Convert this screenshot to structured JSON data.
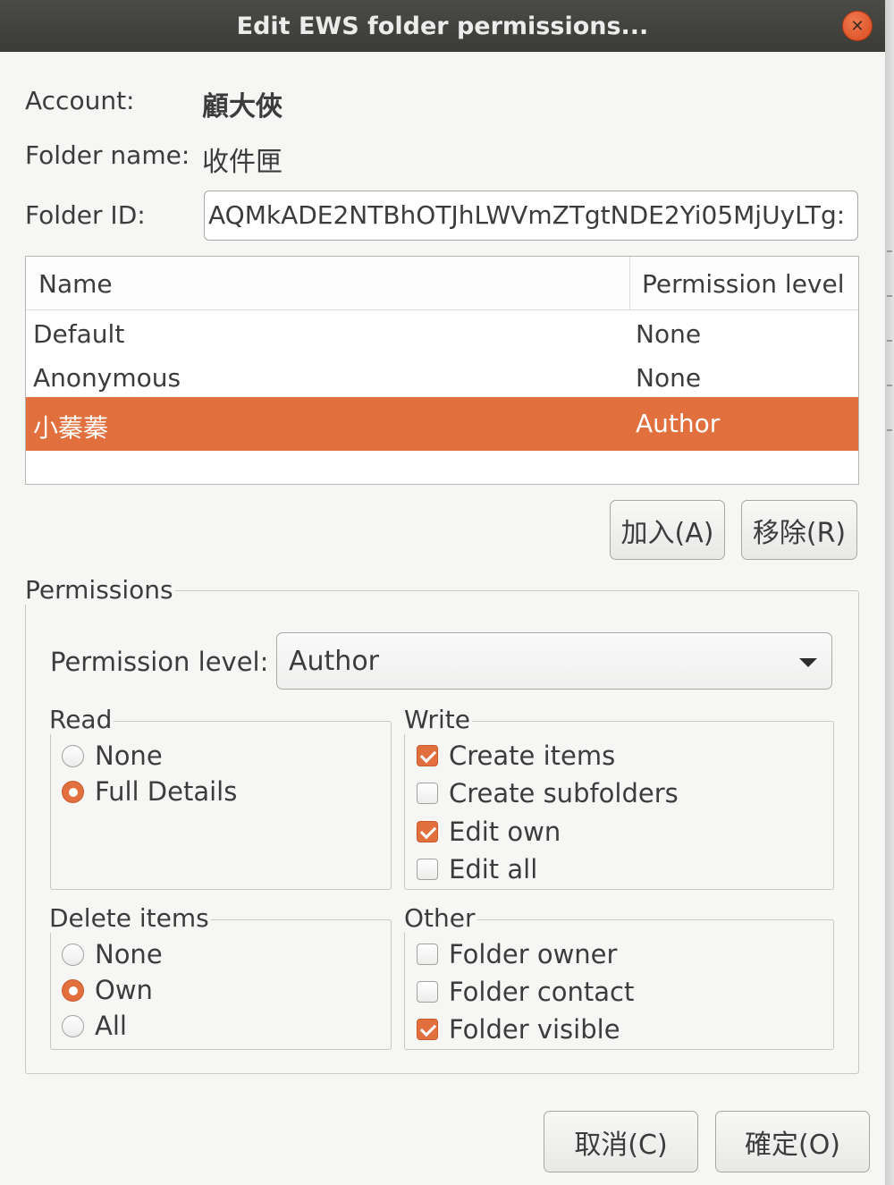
{
  "window": {
    "title": "Edit EWS folder permissions..."
  },
  "account": {
    "label": "Account:",
    "value": "顧大俠"
  },
  "folder_name": {
    "label": "Folder name:",
    "value": "收件匣"
  },
  "folder_id": {
    "label": "Folder ID:",
    "value": "AQMkADE2NTBhOTJhLWVmZTgtNDE2Yi05MjUyLTg:"
  },
  "table": {
    "columns": [
      "Name",
      "Permission level"
    ],
    "rows": [
      {
        "name": "Default",
        "level": "None",
        "selected": false
      },
      {
        "name": "Anonymous",
        "level": "None",
        "selected": false
      },
      {
        "name": "小蓁蓁",
        "level": "Author",
        "selected": true
      }
    ]
  },
  "buttons": {
    "add": "加入(A)",
    "remove": "移除(R)",
    "cancel": "取消(C)",
    "ok": "確定(O)"
  },
  "permissions": {
    "title": "Permissions",
    "level_label": "Permission level:",
    "level_value": "Author",
    "read": {
      "title": "Read",
      "options": [
        "None",
        "Full Details"
      ],
      "selected": "Full Details"
    },
    "write": {
      "title": "Write",
      "items": [
        {
          "label": "Create items",
          "checked": true
        },
        {
          "label": "Create subfolders",
          "checked": false
        },
        {
          "label": "Edit own",
          "checked": true
        },
        {
          "label": "Edit all",
          "checked": false
        }
      ]
    },
    "delete": {
      "title": "Delete items",
      "options": [
        "None",
        "Own",
        "All"
      ],
      "selected": "Own"
    },
    "other": {
      "title": "Other",
      "items": [
        {
          "label": "Folder owner",
          "checked": false
        },
        {
          "label": "Folder contact",
          "checked": false
        },
        {
          "label": "Folder visible",
          "checked": true
        }
      ]
    }
  },
  "icons": {
    "close": "close-icon",
    "dropdown": "chevron-down-icon"
  },
  "colors": {
    "accent": "#e2703f",
    "titlebar": "#3c3b37",
    "background": "#f6f6f5"
  }
}
